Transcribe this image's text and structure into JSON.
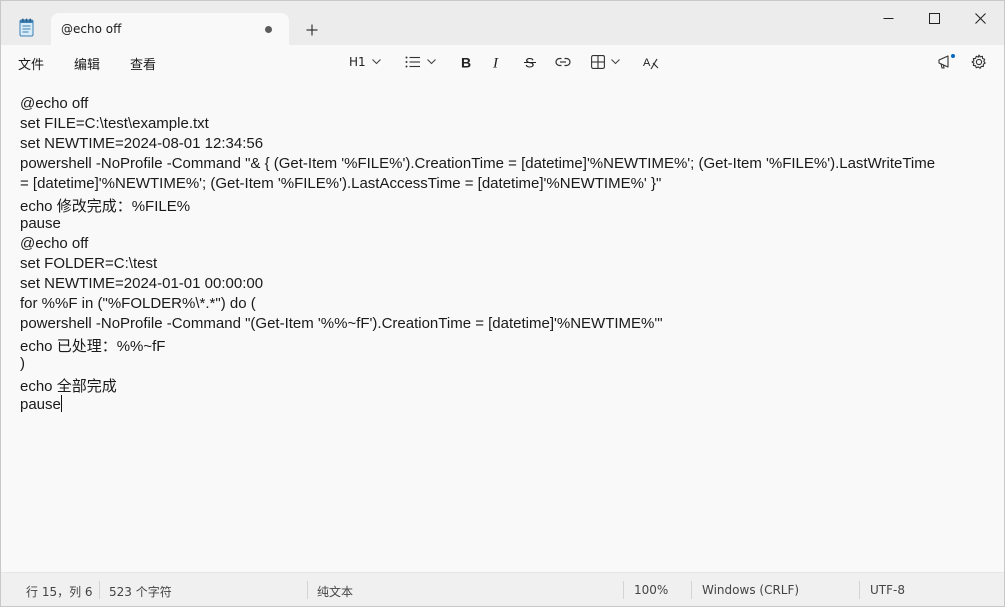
{
  "tab": {
    "title": "@echo off"
  },
  "menu": {
    "file": "文件",
    "edit": "编辑",
    "view": "查看"
  },
  "toolbar": {
    "heading": "H1"
  },
  "editor": {
    "lines": [
      "@echo off",
      "set FILE=C:\\test\\example.txt",
      "set NEWTIME=2024-08-01 12:34:56",
      "powershell -NoProfile -Command \"& { (Get-Item '%FILE%').CreationTime = [datetime]'%NEWTIME%'; (Get-Item '%FILE%').LastWriteTime",
      "= [datetime]'%NEWTIME%'; (Get-Item '%FILE%').LastAccessTime = [datetime]'%NEWTIME%' }\"",
      "echo 修改完成：%FILE%",
      "pause",
      "@echo off",
      "set FOLDER=C:\\test",
      "set NEWTIME=2024-01-01 00:00:00",
      "for %%F in (\"%FOLDER%\\*.*\") do (",
      "powershell -NoProfile -Command \"(Get-Item '%%~fF').CreationTime = [datetime]'%NEWTIME%'\"",
      "echo 已处理：%%~fF",
      ")",
      "echo 全部完成",
      "pause"
    ]
  },
  "status": {
    "position": "行 15，列 6",
    "chars": "523 个字符",
    "format": "纯文本",
    "zoom": "100%",
    "line_ending": "Windows (CRLF)",
    "encoding": "UTF-8"
  },
  "colors": {
    "accent": "#0067c0"
  }
}
